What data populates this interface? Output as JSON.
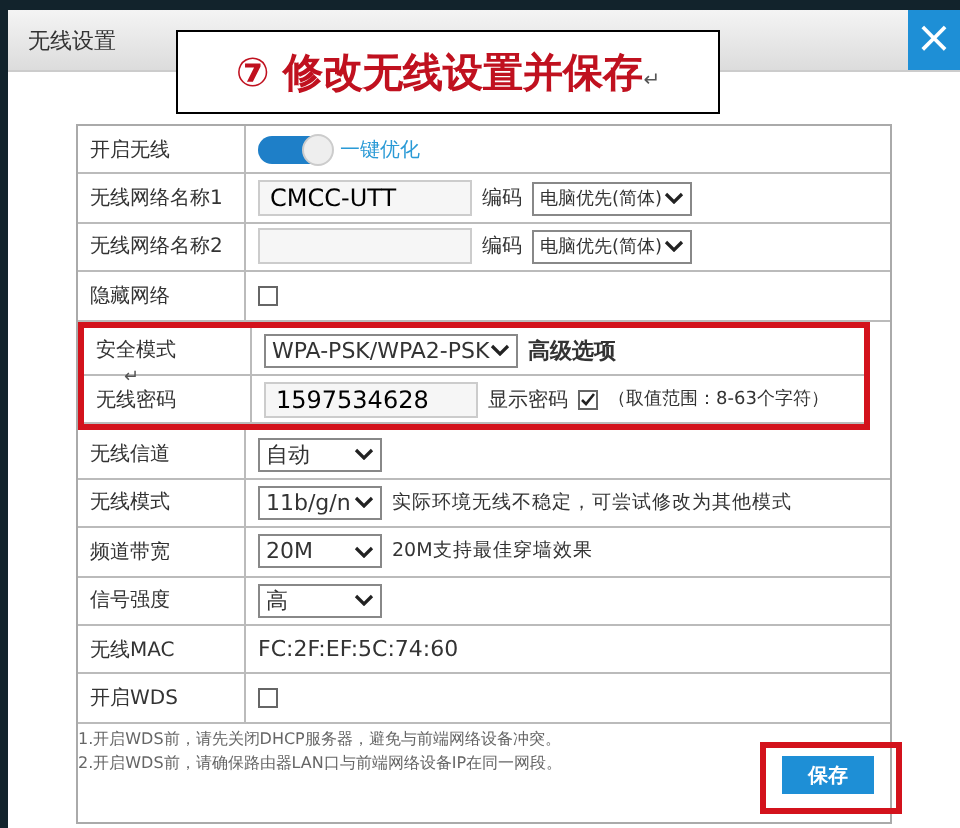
{
  "window": {
    "title": "无线设置",
    "close": "×"
  },
  "annotation": {
    "text": "⑦ 修改无线设置并保存",
    "mark": "↵"
  },
  "rows": [
    {
      "label": "开启无线",
      "kind": "toggle",
      "on": true,
      "link": "一键优化",
      "highlighted": false
    },
    {
      "label": "无线网络名称1",
      "kind": "input",
      "value": "CMCC-UTT",
      "extra_label": "编码",
      "extra_select": "电脑优先(简体)",
      "highlighted": false
    },
    {
      "label": "无线网络名称2",
      "kind": "input",
      "value": "",
      "extra_label": "编码",
      "extra_select": "电脑优先(简体)",
      "highlighted": false
    },
    {
      "label": "隐藏网络",
      "kind": "checkbox",
      "checked": false,
      "highlighted": false
    },
    {
      "label": "安全模式",
      "kind": "select_wide",
      "value": "WPA-PSK/WPA2-PSK",
      "note": "高级选项",
      "highlighted": true
    },
    {
      "label": "无线密码",
      "kind": "password",
      "value": "1597534628",
      "show_label": "显示密码",
      "show_checked": true,
      "hint": "（取值范围：8-63个字符）",
      "mark": "↵",
      "highlighted": true
    },
    {
      "label": "无线信道",
      "kind": "select",
      "value": "自动",
      "highlighted": false
    },
    {
      "label": "无线模式",
      "kind": "select",
      "value": "11b/g/n",
      "note": "实际环境无线不稳定，可尝试修改为其他模式",
      "highlighted": false
    },
    {
      "label": "频道带宽",
      "kind": "select",
      "value": "20M",
      "note": "20M支持最佳穿墙效果",
      "highlighted": false
    },
    {
      "label": "信号强度",
      "kind": "select",
      "value": "高",
      "highlighted": false
    },
    {
      "label": "无线MAC",
      "kind": "text",
      "value": "FC:2F:EF:5C:74:60",
      "highlighted": false
    },
    {
      "label": "开启WDS",
      "kind": "checkbox",
      "checked": false,
      "highlighted": false
    }
  ],
  "notes": [
    "1.开启WDS前，请先关闭DHCP服务器，避免与前端网络设备冲突。",
    "2.开启WDS前，请确保路由器LAN口与前端网络设备IP在同一网段。"
  ],
  "save_button": {
    "label": "保存",
    "highlighted": true
  }
}
